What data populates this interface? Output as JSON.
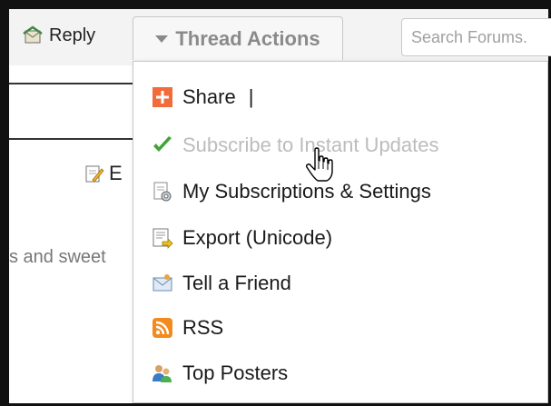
{
  "toolbar": {
    "reply_label": "Reply",
    "thread_actions_label": "Thread Actions",
    "search_placeholder": "Search Forums."
  },
  "background": {
    "edit_fragment": "E",
    "body_fragment": "s and sweet"
  },
  "menu": {
    "items": [
      {
        "label": "Share",
        "separator": "|",
        "icon": "share-plus-icon",
        "enabled": true
      },
      {
        "label": "Subscribe to Instant Updates",
        "icon": "checkmark-icon",
        "enabled": false
      },
      {
        "label": "My Subscriptions & Settings",
        "icon": "subscriptions-settings-icon",
        "enabled": true
      },
      {
        "label": "Export (Unicode)",
        "icon": "export-icon",
        "enabled": true
      },
      {
        "label": "Tell a Friend",
        "icon": "envelope-icon",
        "enabled": true
      },
      {
        "label": "RSS",
        "icon": "rss-icon",
        "enabled": true
      },
      {
        "label": "Top Posters",
        "icon": "top-posters-icon",
        "enabled": true
      }
    ]
  },
  "colors": {
    "share_icon": "#f26b3a",
    "check_icon": "#3fa535",
    "rss_icon": "#f28a1e",
    "disabled_text": "#bcbcbc"
  }
}
